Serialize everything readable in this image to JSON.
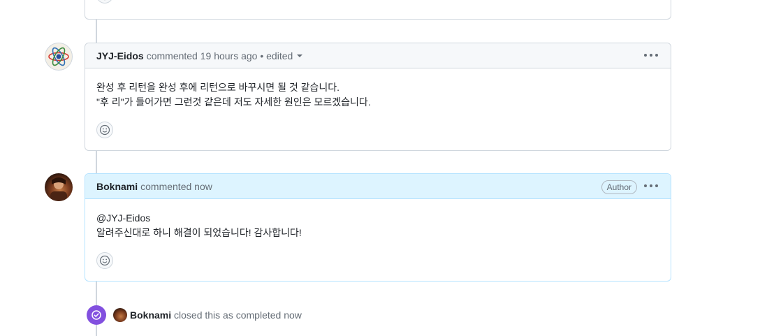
{
  "comments": [
    {
      "author": "JYJ-Eidos",
      "meta": "commented 19 hours ago • edited",
      "lines": [
        "완성 후 리턴을 완성 후에 리턴으로 바꾸시면 될 것 같습니다.",
        "\"후 리\"가 들어가면 그런것 같은데 저도 자세한 원인은 모르겠습니다."
      ]
    },
    {
      "author": "Boknami",
      "meta": "commented now",
      "badge": "Author",
      "lines": [
        "@JYJ-Eidos",
        "알려주신대로 하니 해결이 되었습니다! 감사합니다!"
      ]
    }
  ],
  "event": {
    "user": "Boknami",
    "text": "closed this as completed now"
  },
  "colors": {
    "closed_badge": "#8250df",
    "author_header": "#ddf4ff"
  }
}
